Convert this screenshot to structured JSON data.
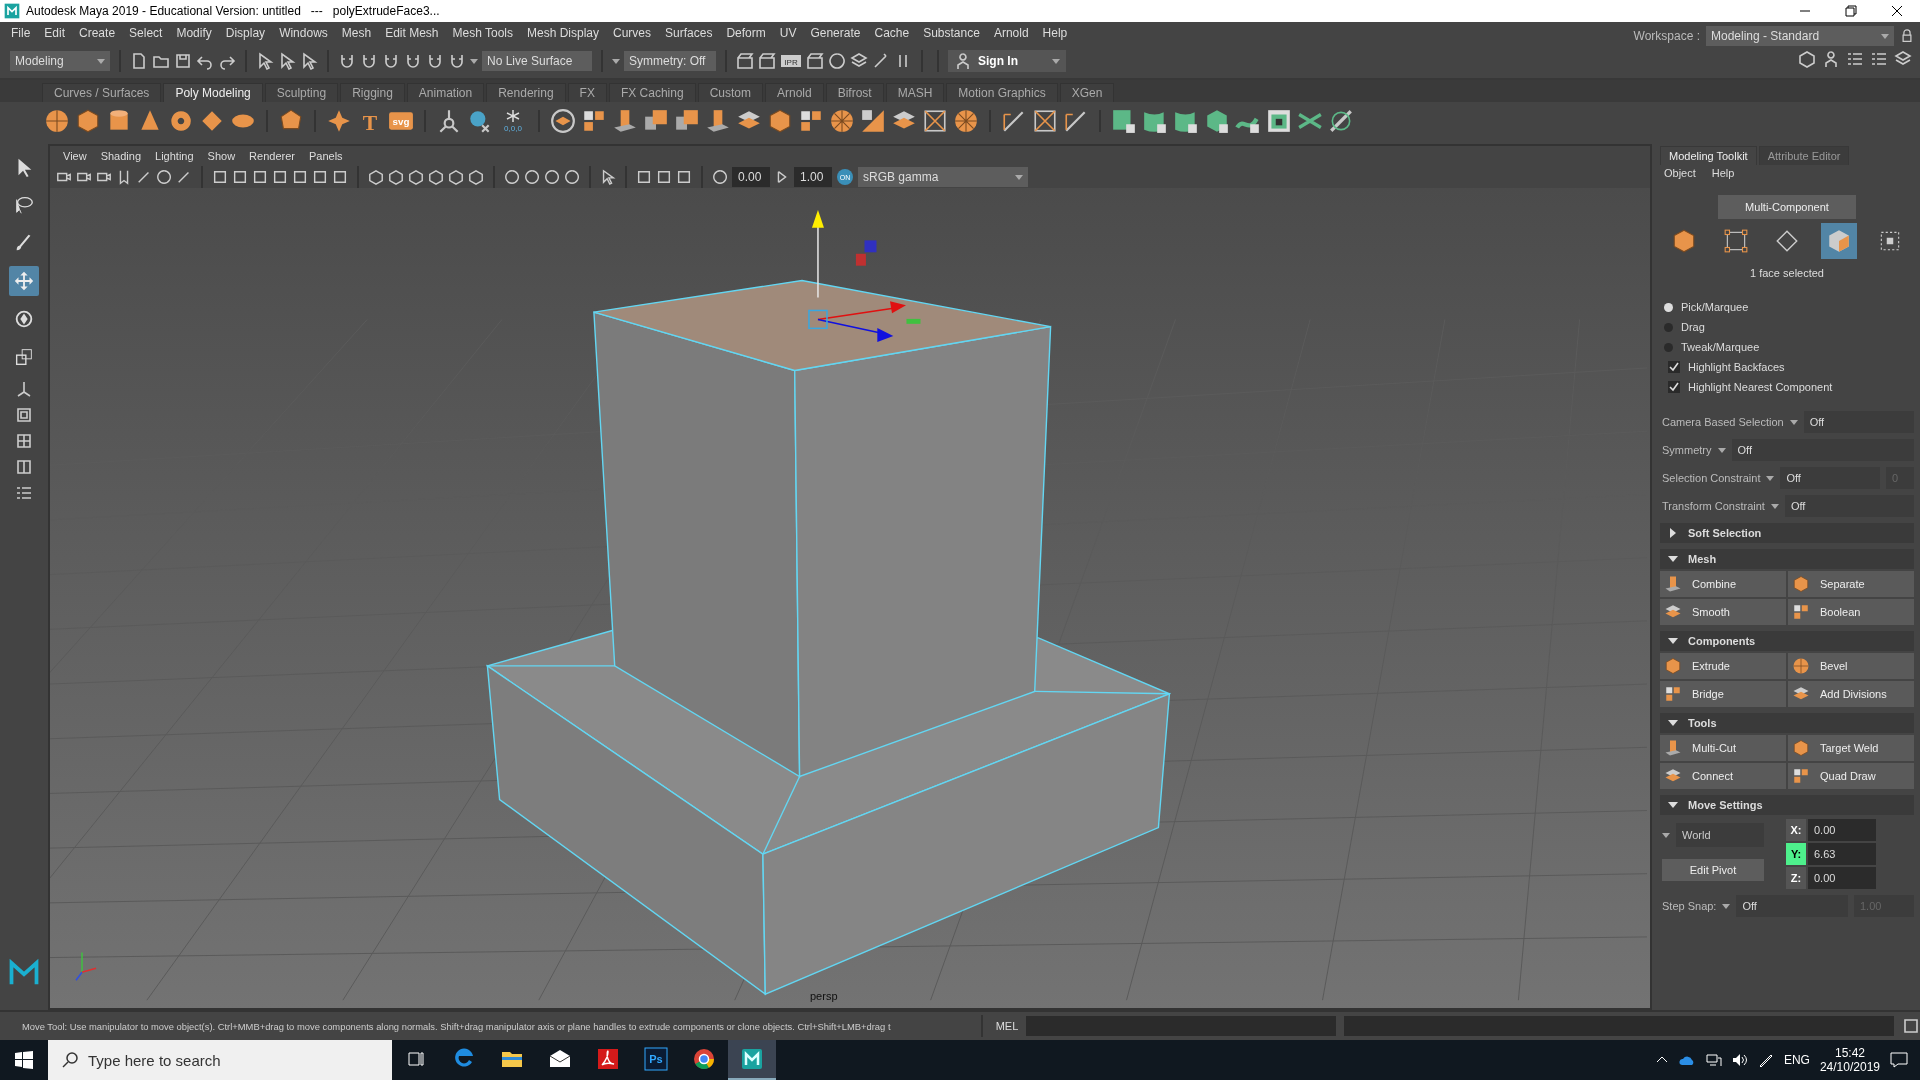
{
  "window": {
    "title": "Autodesk Maya 2019 - Educational Version: untitled   ---   polyExtrudeFace3..."
  },
  "menu_bar": [
    "File",
    "Edit",
    "Create",
    "Select",
    "Modify",
    "Display",
    "Windows",
    "Mesh",
    "Edit Mesh",
    "Mesh Tools",
    "Mesh Display",
    "Curves",
    "Surfaces",
    "Deform",
    "UV",
    "Generate",
    "Cache",
    "Substance",
    "Arnold",
    "Help"
  ],
  "status_line": {
    "menu_set": "Modeling",
    "live_surface": "No Live Surface",
    "symmetry": "Symmetry: Off",
    "ipr_label": "IPR",
    "sign_in": "Sign In",
    "workspace_label": "Workspace :",
    "workspace": "Modeling - Standard"
  },
  "shelf": {
    "tabs": [
      {
        "label": "Curves / Surfaces",
        "selected": false
      },
      {
        "label": "Poly Modeling",
        "selected": true
      },
      {
        "label": "Sculpting",
        "selected": false
      },
      {
        "label": "Rigging",
        "selected": false
      },
      {
        "label": "Animation",
        "selected": false
      },
      {
        "label": "Rendering",
        "selected": false
      },
      {
        "label": "FX",
        "selected": false
      },
      {
        "label": "FX Caching",
        "selected": false
      },
      {
        "label": "Custom",
        "selected": false
      },
      {
        "label": "Arnold",
        "selected": false
      },
      {
        "label": "Bifrost",
        "selected": false
      },
      {
        "label": "MASH",
        "selected": false
      },
      {
        "label": "Motion Graphics",
        "selected": false
      },
      {
        "label": "XGen",
        "selected": false
      }
    ],
    "type_label": "T",
    "svg_label": "svg",
    "pivot_label": "0,0,0"
  },
  "viewport": {
    "menus": [
      "View",
      "Shading",
      "Lighting",
      "Show",
      "Renderer",
      "Panels"
    ],
    "exposure": "0.00",
    "gamma": "1.00",
    "color_badge": "ON",
    "view_transform": "sRGB gamma",
    "camera": "persp"
  },
  "toolbox": {
    "tools": [
      {
        "selected": false
      },
      {
        "selected": false
      },
      {
        "selected": false
      },
      {
        "selected": true
      },
      {
        "selected": false
      },
      {
        "selected": false
      }
    ]
  },
  "toolkit": {
    "tabs": [
      {
        "label": "Modeling Toolkit",
        "selected": true
      },
      {
        "label": "Attribute Editor",
        "selected": false
      }
    ],
    "menus": [
      "Object",
      "Help"
    ],
    "mode": "Multi-Component",
    "components": [
      {
        "selected": false
      },
      {
        "selected": false
      },
      {
        "selected": false
      },
      {
        "selected": true
      },
      {
        "selected": false
      }
    ],
    "selection_info": "1 face selected",
    "pick_modes": [
      {
        "label": "Pick/Marquee",
        "selected": true
      },
      {
        "label": "Drag",
        "selected": false
      },
      {
        "label": "Tweak/Marquee",
        "selected": false
      }
    ],
    "options": [
      {
        "label": "Highlight Backfaces",
        "checked": true
      },
      {
        "label": "Highlight Nearest Component",
        "checked": true
      }
    ],
    "settings": [
      {
        "label": "Camera Based Selection",
        "value": "Off"
      },
      {
        "label": "Symmetry",
        "value": "Off"
      },
      {
        "label": "Selection Constraint",
        "value": "Off",
        "extra": "0"
      },
      {
        "label": "Transform Constraint",
        "value": "Off"
      }
    ],
    "sections": [
      {
        "title": "Soft Selection",
        "expanded": false
      },
      {
        "title": "Mesh",
        "expanded": true,
        "buttons": [
          "Combine",
          "Separate",
          "Smooth",
          "Boolean"
        ]
      },
      {
        "title": "Components",
        "expanded": true,
        "buttons": [
          "Extrude",
          "Bevel",
          "Bridge",
          "Add Divisions"
        ]
      },
      {
        "title": "Tools",
        "expanded": true,
        "buttons": [
          "Multi-Cut",
          "Target Weld",
          "Connect",
          "Quad Draw"
        ]
      }
    ],
    "move_settings": {
      "title": "Move Settings",
      "expanded": true,
      "space": "World",
      "pivot_button": "Edit Pivot",
      "axes": [
        {
          "label": "X:",
          "value": "0.00",
          "selected": false
        },
        {
          "label": "Y:",
          "value": "6.63",
          "selected": true
        },
        {
          "label": "Z:",
          "value": "0.00",
          "selected": false
        }
      ],
      "step_snap_label": "Step Snap:",
      "step_snap": "Off",
      "step_value": "1.00"
    }
  },
  "help_line": "Move Tool: Use manipulator to move object(s). Ctrl+MMB+drag to move components along normals. Shift+drag manipulator axis or plane handles to extrude components or clone objects. Ctrl+Shift+LMB+drag t",
  "command_line": {
    "language": "MEL"
  },
  "taskbar": {
    "search_placeholder": "Type here to search",
    "apps": [
      {
        "kind": "taskview",
        "selected": false
      },
      {
        "kind": "edge",
        "selected": false
      },
      {
        "kind": "explorer",
        "selected": false
      },
      {
        "kind": "mail",
        "selected": false
      },
      {
        "kind": "acrobat",
        "selected": false
      },
      {
        "kind": "photoshop",
        "label": "Ps",
        "selected": false
      },
      {
        "kind": "chrome",
        "selected": false
      },
      {
        "kind": "maya",
        "selected": true
      }
    ],
    "language": "ENG",
    "time": "15:42",
    "date": "24/10/2019"
  }
}
